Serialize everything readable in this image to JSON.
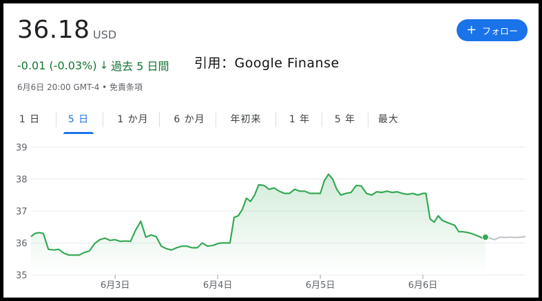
{
  "header": {
    "price": "36.18",
    "currency": "USD",
    "change": "-0.01 (-0.03%)",
    "change_arrow": "↓",
    "period": "過去 5 日間",
    "meta": "6月6日 20:00 GMT-4 • 免責条項",
    "citation": "引用：Google Finanse",
    "follow_label": "フォロー",
    "follow_icon": "+"
  },
  "tabs": [
    {
      "label": "1 日"
    },
    {
      "label": "5 日"
    },
    {
      "label": "1 か月"
    },
    {
      "label": "6 か月"
    },
    {
      "label": "年初来"
    },
    {
      "label": "1 年"
    },
    {
      "label": "5 年"
    },
    {
      "label": "最大"
    }
  ],
  "active_tab": 1,
  "colors": {
    "line": "#34a853",
    "marker": "#34a853",
    "after_hours": "#bdc1c6",
    "grid": "#e8eaed",
    "accent": "#1a73e8",
    "positive_text": "#137333"
  },
  "chart_data": {
    "type": "line",
    "title": "",
    "xlabel": "",
    "ylabel": "",
    "ylim": [
      35,
      39
    ],
    "yticks": [
      "35",
      "36",
      "37",
      "38",
      "39"
    ],
    "xtick_labels": [
      "6月3日",
      "6月4日",
      "6月5日",
      "6月6日"
    ],
    "xlim": [
      2.18,
      7.0
    ],
    "xtick_positions": [
      3,
      4,
      5,
      6
    ],
    "series": [
      {
        "x": [
          2.18,
          2.22,
          2.26,
          2.3,
          2.35,
          2.4,
          2.45,
          2.5,
          2.55,
          2.6,
          2.65,
          2.7,
          2.75,
          2.8,
          2.85,
          2.9,
          2.95,
          3.0,
          3.05,
          3.1,
          3.15,
          3.2,
          3.25,
          3.3,
          3.35,
          3.4,
          3.45,
          3.5,
          3.55,
          3.6,
          3.65,
          3.7,
          3.75,
          3.8,
          3.85,
          3.9,
          3.95,
          3.98,
          4.0,
          4.04,
          4.08,
          4.12,
          4.16,
          4.2,
          4.24,
          4.28,
          4.32,
          4.36,
          4.4,
          4.45,
          4.5,
          4.55,
          4.6,
          4.65,
          4.7,
          4.75,
          4.8,
          4.85,
          4.9,
          4.95,
          5.0,
          5.04,
          5.08,
          5.12,
          5.16,
          5.2,
          5.25,
          5.3,
          5.35,
          5.4,
          5.45,
          5.5,
          5.55,
          5.6,
          5.65,
          5.7,
          5.75,
          5.8,
          5.85,
          5.9,
          5.95,
          6.0,
          6.03,
          6.07,
          6.11,
          6.15,
          6.19,
          6.23,
          6.27,
          6.31,
          6.35,
          6.39,
          6.43,
          6.47,
          6.51,
          6.55,
          6.58,
          6.61
        ],
        "values": [
          36.2,
          36.3,
          36.32,
          36.3,
          35.8,
          35.78,
          35.8,
          35.68,
          35.62,
          35.62,
          35.62,
          35.7,
          35.75,
          35.98,
          36.1,
          36.15,
          36.08,
          36.1,
          36.05,
          36.06,
          36.05,
          36.4,
          36.68,
          36.18,
          36.25,
          36.2,
          35.9,
          35.82,
          35.78,
          35.85,
          35.9,
          35.9,
          35.85,
          35.85,
          36.0,
          35.9,
          35.92,
          35.95,
          35.98,
          36.0,
          36.0,
          36.0,
          36.8,
          36.85,
          37.05,
          37.4,
          37.3,
          37.5,
          37.82,
          37.8,
          37.68,
          37.72,
          37.62,
          37.55,
          37.55,
          37.68,
          37.62,
          37.62,
          37.55,
          37.55,
          37.55,
          37.95,
          38.15,
          38.0,
          37.68,
          37.5,
          37.55,
          37.58,
          37.8,
          37.78,
          37.55,
          37.5,
          37.6,
          37.58,
          37.62,
          37.58,
          37.6,
          37.55,
          37.52,
          37.55,
          37.5,
          37.55,
          37.55,
          36.75,
          36.65,
          36.85,
          36.7,
          36.65,
          36.6,
          36.55,
          36.35,
          36.35,
          36.33,
          36.3,
          36.25,
          36.2,
          36.15,
          36.18
        ]
      },
      {
        "x": [
          6.61,
          6.65,
          6.7,
          6.75,
          6.8,
          6.85,
          6.9,
          6.95,
          7.0
        ],
        "values": [
          36.18,
          36.15,
          36.1,
          36.18,
          36.17,
          36.18,
          36.17,
          36.18,
          36.2
        ]
      }
    ]
  }
}
